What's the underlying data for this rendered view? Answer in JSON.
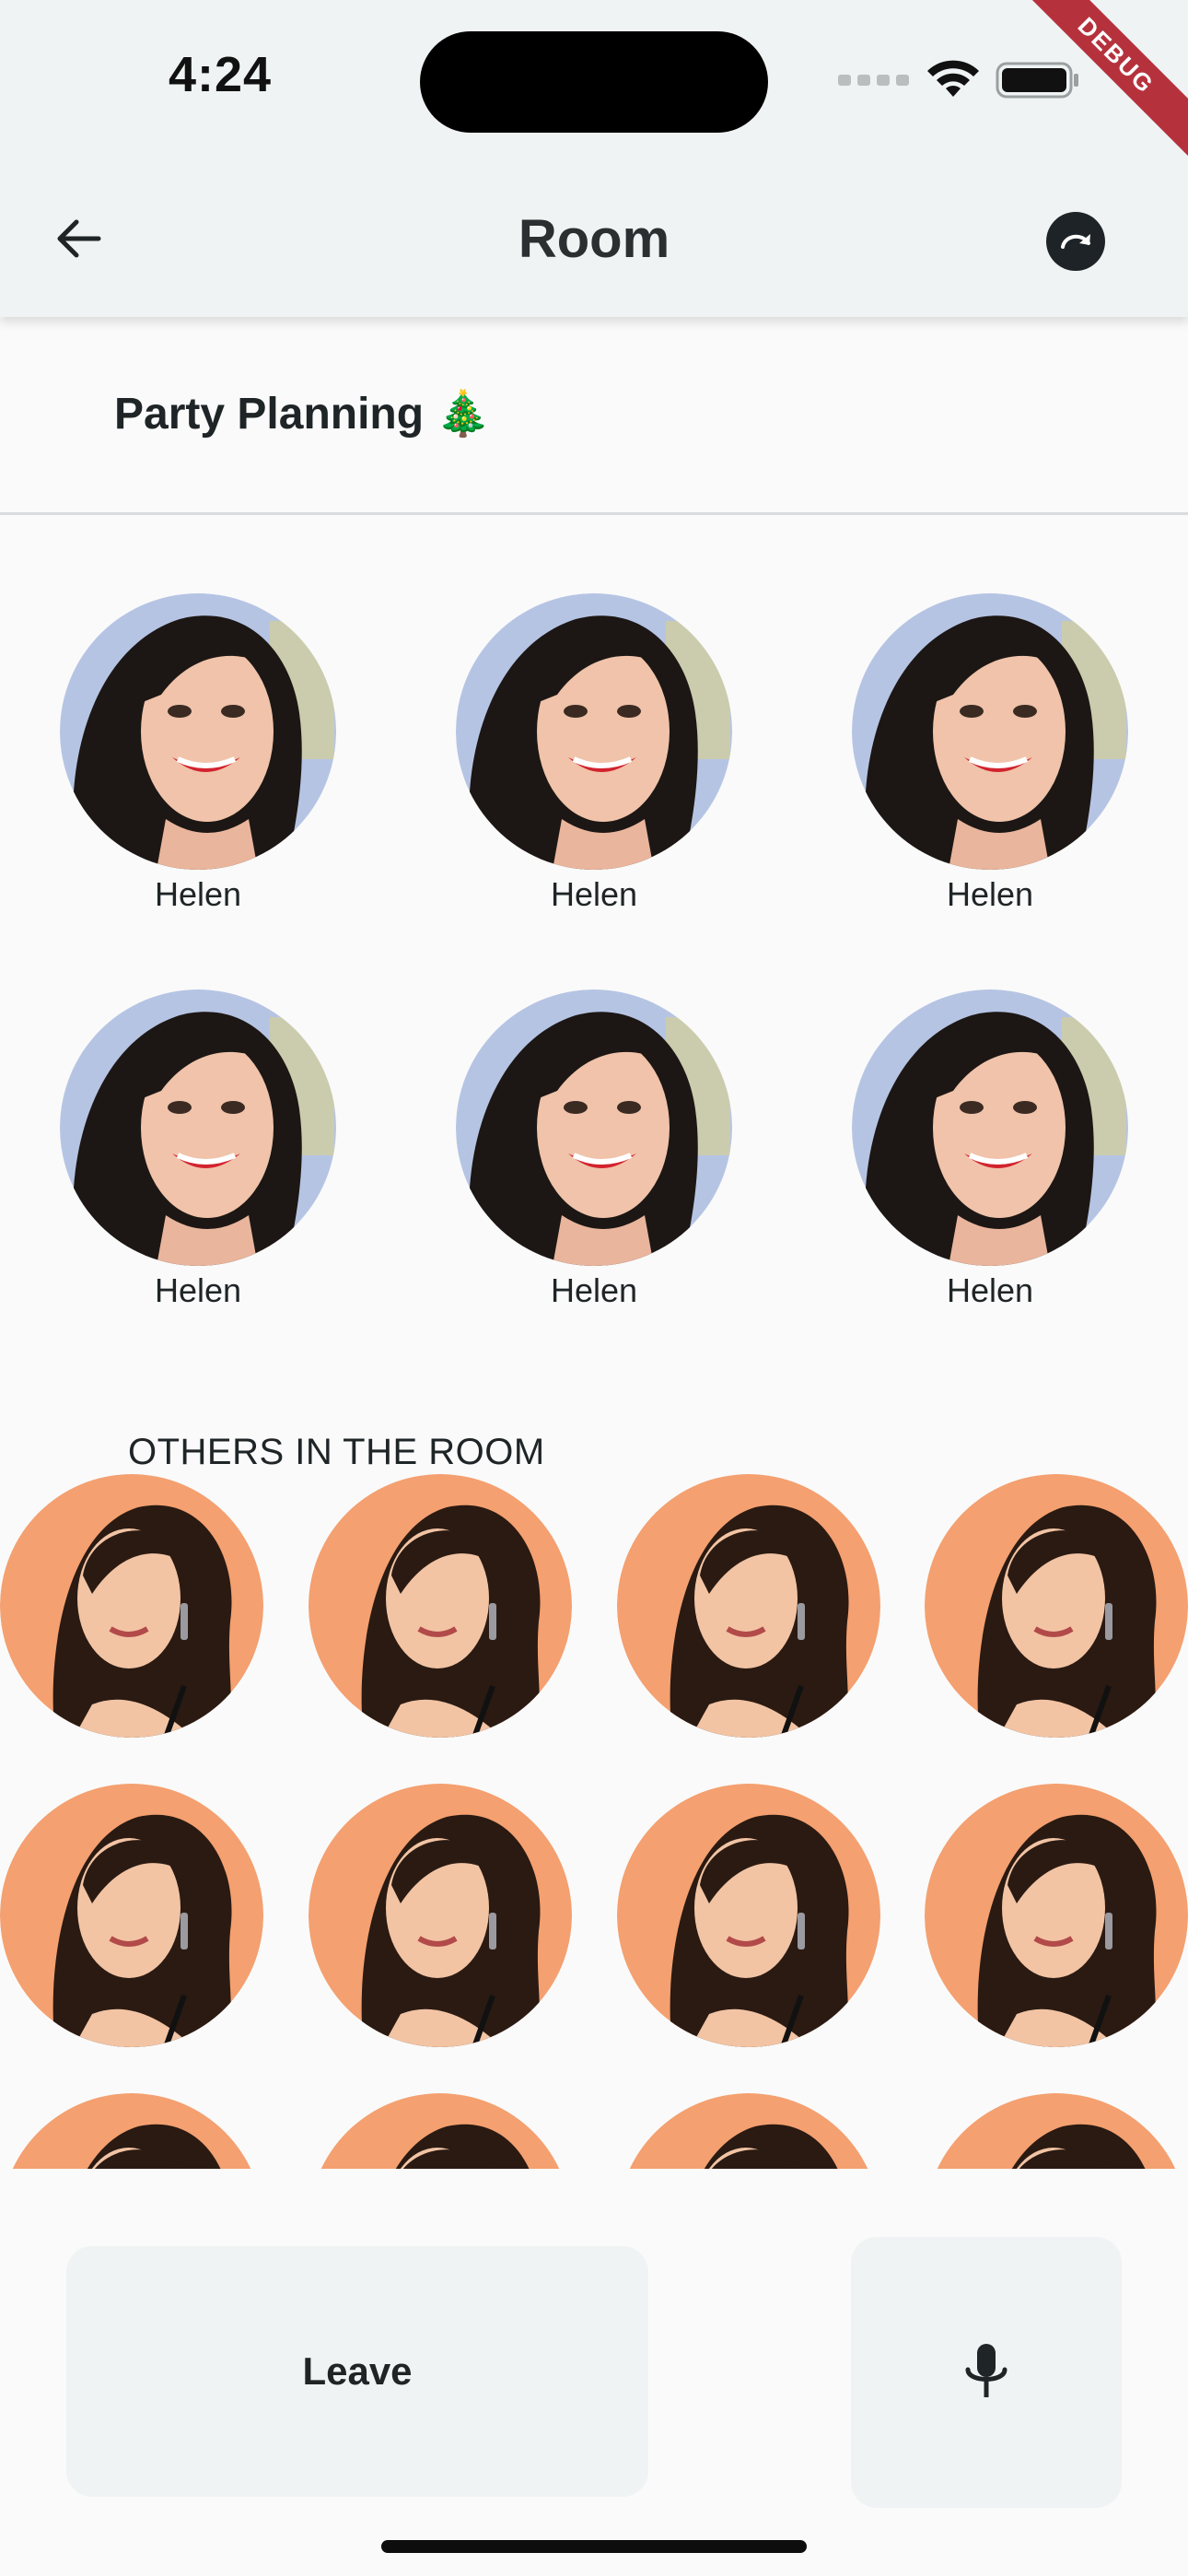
{
  "status_bar": {
    "time": "4:24"
  },
  "debug_banner": "DEBUG",
  "app_bar": {
    "title": "Room",
    "back_icon": "arrow-left-icon",
    "action_icon": "redo-circle-icon"
  },
  "room": {
    "name": "Party Planning 🎄"
  },
  "speakers": [
    {
      "name": "Helen"
    },
    {
      "name": "Helen"
    },
    {
      "name": "Helen"
    },
    {
      "name": "Helen"
    },
    {
      "name": "Helen"
    },
    {
      "name": "Helen"
    }
  ],
  "others_section": {
    "label": "OTHERS IN THE ROOM"
  },
  "bottom_bar": {
    "leave_label": "Leave",
    "mic_icon": "microphone-icon"
  },
  "colors": {
    "app_bar_bg": "#eff3f3",
    "page_bg": "#fafafa",
    "debug_ribbon": "#b5323d",
    "speaker_avatar_bg": "#b6c4e4",
    "listener_avatar_bg": "#f4a070"
  }
}
